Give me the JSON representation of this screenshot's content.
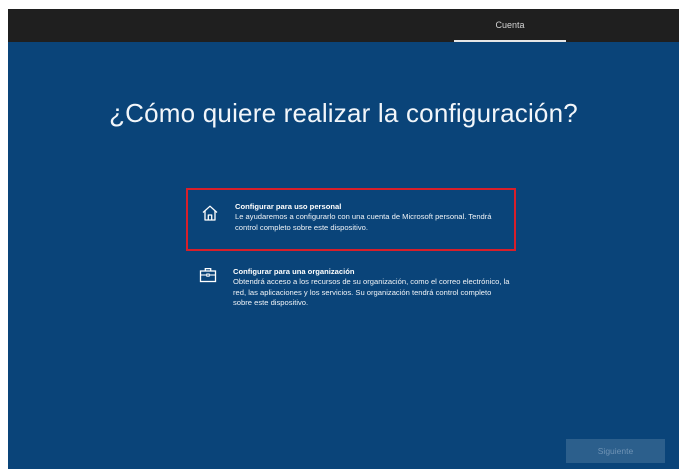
{
  "header": {
    "tab_label": "Cuenta"
  },
  "main": {
    "title": "¿Cómo quiere realizar la configuración?",
    "options": [
      {
        "icon": "home-icon",
        "title": "Configurar para uso personal",
        "description": "Le ayudaremos a configurarlo con una cuenta de Microsoft personal. Tendrá control completo sobre este dispositivo."
      },
      {
        "icon": "briefcase-icon",
        "title": "Configurar para una organización",
        "description": "Obtendrá acceso a los recursos de su organización, como el correo electrónico, la red, las aplicaciones y los servicios. Su organización tendrá control completo sobre este dispositivo."
      }
    ]
  },
  "footer": {
    "next_label": "Siguiente"
  },
  "colors": {
    "background": "#0a4479",
    "topbar": "#1f1f1f",
    "highlight_border": "#d81f2a",
    "next_button": "#2c5f8c"
  }
}
